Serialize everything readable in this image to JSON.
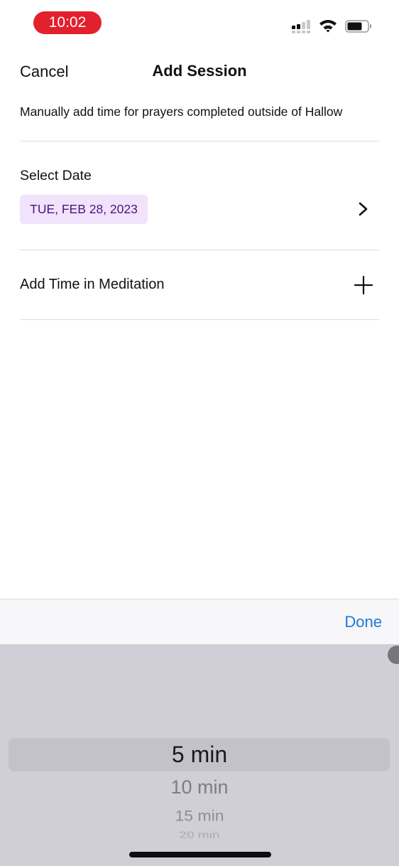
{
  "status_bar": {
    "time": "10:02",
    "icons": [
      "cellular-signal-icon",
      "wifi-icon",
      "battery-icon"
    ],
    "time_pill_color": "#e3202d"
  },
  "nav": {
    "cancel_label": "Cancel",
    "title": "Add Session"
  },
  "subtitle": "Manually add time for prayers completed outside of Hallow",
  "date_section": {
    "label": "Select Date",
    "selected_date": "TUE, FEB 28, 2023",
    "chip_bg_color": "#f1e3fb",
    "chip_text_color": "#4e137f",
    "action_icon": "chevron-right-icon"
  },
  "meditation_section": {
    "label": "Add Time in Meditation",
    "action_icon": "plus-icon"
  },
  "toolbar": {
    "done_label": "Done",
    "accent_color": "#1a7ad8"
  },
  "picker": {
    "selected": "5 min",
    "options": [
      "5 min",
      "10 min",
      "15 min",
      "20 min"
    ]
  }
}
